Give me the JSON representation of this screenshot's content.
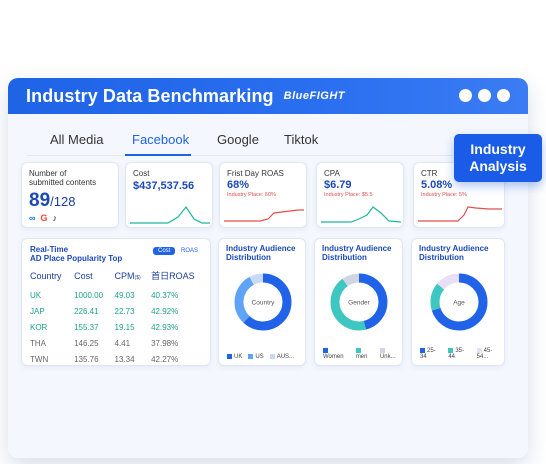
{
  "window": {
    "title": "Industry Data Benchmarking",
    "brand": "BlueFIGHT"
  },
  "tabs": [
    "All Media",
    "Facebook",
    "Google",
    "Tiktok"
  ],
  "active_tab": "Facebook",
  "badge": {
    "line1": "Industry",
    "line2": "Analysis"
  },
  "metrics": {
    "submitted": {
      "label1": "Number of",
      "label2": "submitted contents",
      "value": "89",
      "total": "/128"
    },
    "cost": {
      "label": "Cost",
      "value": "$437,537.56"
    },
    "roas": {
      "label": "Frist Day ROAS",
      "value": "68%",
      "sub": "Industry Place: 60%"
    },
    "cpa": {
      "label": "CPA",
      "value": "$6.79",
      "sub": "Industry Place: $5.5"
    },
    "ctr": {
      "label": "CTR",
      "value": "5.08%",
      "sub": "Industry Place: 5%"
    }
  },
  "realtime": {
    "title1": "Real-Time",
    "title2": "AD Place Popularity Top",
    "toggle_on": "Cost",
    "toggle_off": "ROAS",
    "headers": [
      "Country",
      "Cost",
      "CPM",
      "首日ROAS"
    ],
    "cpm_unit": "($)",
    "rows": [
      [
        "UK",
        "1000.00",
        "49.03",
        "40.37%"
      ],
      [
        "JAP",
        "226.41",
        "22.73",
        "42.92%"
      ],
      [
        "KOR",
        "155.37",
        "19.15",
        "42.93%"
      ],
      [
        "THA",
        "146.25",
        "4.41",
        "37.98%"
      ],
      [
        "TWN",
        "135.76",
        "13.34",
        "42.27%"
      ]
    ]
  },
  "distributions": [
    {
      "title1": "Industry Audience",
      "title2": "Distribution",
      "center": "Country",
      "legend": [
        "UK",
        "US",
        "AUS..."
      ],
      "colors": [
        "#2062e8",
        "#5ea3f5",
        "#c9d9f5"
      ],
      "shares": [
        0.62,
        0.3,
        0.08
      ]
    },
    {
      "title1": "Industry Audience",
      "title2": "Distribution",
      "center": "Gender",
      "legend": [
        "Women",
        "men",
        "Unk..."
      ],
      "colors": [
        "#2062e8",
        "#3ec6c0",
        "#cfd5e2"
      ],
      "shares": [
        0.46,
        0.44,
        0.1
      ]
    },
    {
      "title1": "Industry Audience",
      "title2": "Distribution",
      "center": "Age",
      "legend": [
        "25-34",
        "35-44",
        "45-54..."
      ],
      "colors": [
        "#2062e8",
        "#3ec6c0",
        "#e8def5"
      ],
      "shares": [
        0.7,
        0.16,
        0.14
      ]
    }
  ],
  "colors": {
    "primary": "#2062e8",
    "green": "#1fa08c",
    "red": "#e0504a"
  }
}
